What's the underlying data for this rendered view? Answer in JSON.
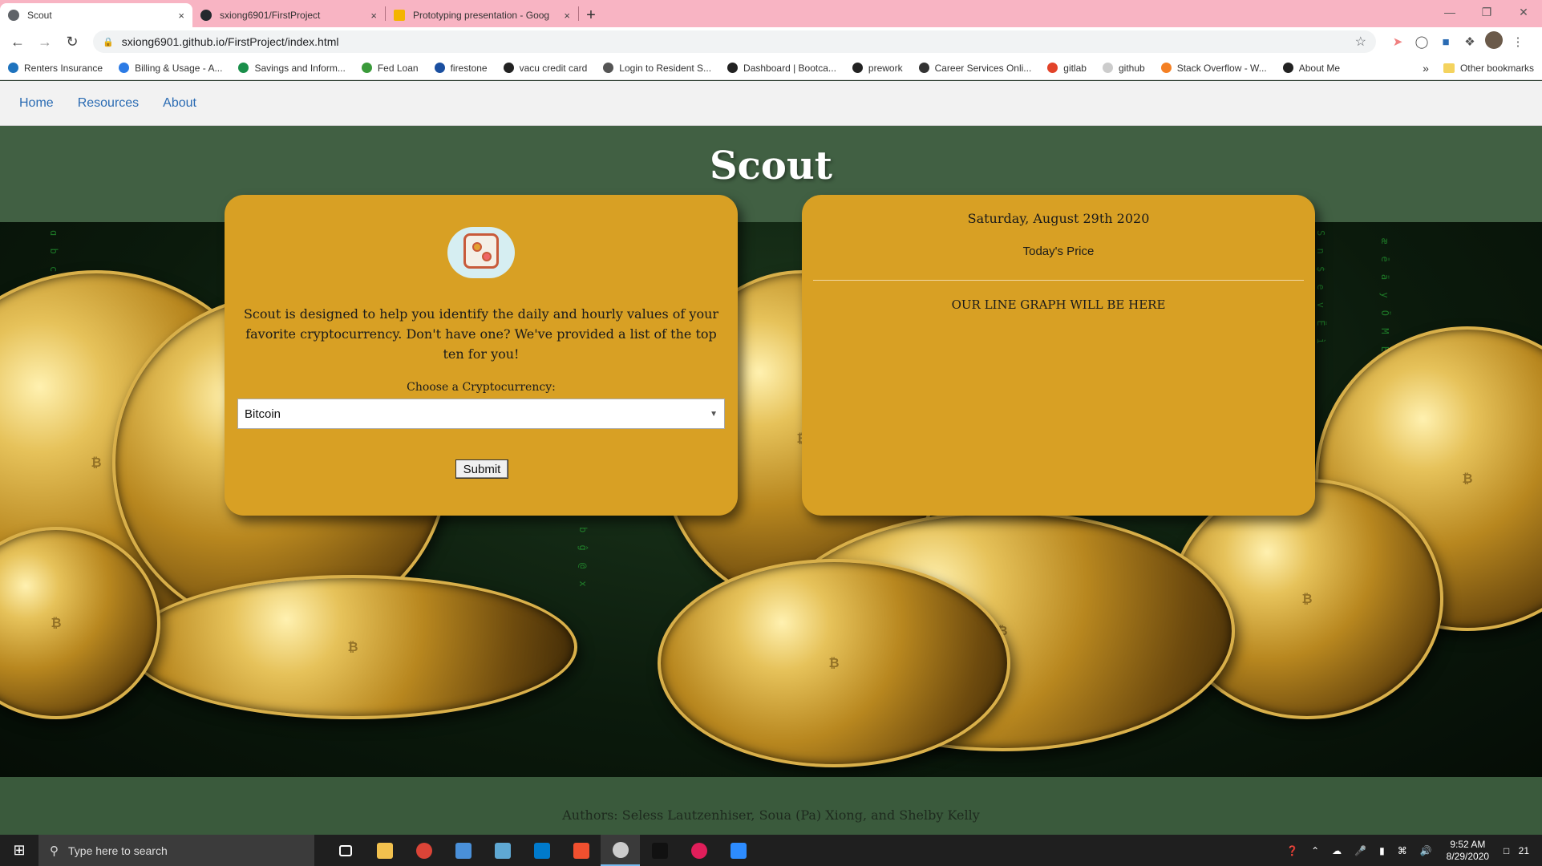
{
  "browser": {
    "tabs": [
      {
        "title": "Scout",
        "favicon_color": "#5f6368",
        "active": true
      },
      {
        "title": "sxiong6901/FirstProject",
        "favicon_color": "#24292e",
        "active": false
      },
      {
        "title": "Prototyping presentation - Goog",
        "favicon_color": "#f4b400",
        "active": false
      }
    ],
    "close_glyph": "×",
    "new_tab_glyph": "+",
    "url": "sxiong6901.github.io/FirstProject/index.html",
    "bookmarks": [
      {
        "label": "Renters Insurance",
        "color": "#1e73be"
      },
      {
        "label": "Billing & Usage - A...",
        "color": "#2c7be5"
      },
      {
        "label": "Savings and Inform...",
        "color": "#1a8f4a"
      },
      {
        "label": "Fed Loan",
        "color": "#3a9a3a"
      },
      {
        "label": "firestone",
        "color": "#1a4fa0"
      },
      {
        "label": "vacu credit card",
        "color": "#222222"
      },
      {
        "label": "Login to Resident S...",
        "color": "#555555"
      },
      {
        "label": "Dashboard | Bootca...",
        "color": "#222222"
      },
      {
        "label": "prework",
        "color": "#222222"
      },
      {
        "label": "Career Services Onli...",
        "color": "#333333"
      },
      {
        "label": "gitlab",
        "color": "#e24329"
      },
      {
        "label": "github",
        "color": "#cccccc"
      },
      {
        "label": "Stack Overflow - W...",
        "color": "#f48024"
      },
      {
        "label": "About Me",
        "color": "#222222"
      }
    ],
    "other_bookmarks": "Other bookmarks",
    "chevron": "»"
  },
  "site": {
    "nav": [
      "Home",
      "Resources",
      "About"
    ],
    "title": "Scout",
    "description": "Scout is designed to help you identify the daily and hourly values of your favorite cryptocurrency. Don't have one? We've provided a list of the top ten for you!",
    "choose_label": "Choose a Cryptocurrency:",
    "selected_crypto": "Bitcoin",
    "submit_label": "Submit",
    "date": "Saturday, August 29th 2020",
    "price_label": "Today's Price",
    "graph_placeholder": "OUR LINE GRAPH WILL BE HERE",
    "footer": "Authors: Seless Lautzenhiser, Soua (Pa) Xiong, and Shelby Kelly"
  },
  "taskbar": {
    "search_placeholder": "Type here to search",
    "apps": [
      {
        "name": "task-view",
        "color": "#ffffff"
      },
      {
        "name": "file-explorer",
        "color": "#f2c14e"
      },
      {
        "name": "chrome",
        "color": "#db4437"
      },
      {
        "name": "calculator",
        "color": "#4a90d9"
      },
      {
        "name": "notepad",
        "color": "#5fa8d3"
      },
      {
        "name": "vscode",
        "color": "#007acc"
      },
      {
        "name": "git",
        "color": "#f1502f"
      },
      {
        "name": "photos",
        "color": "#cccccc"
      },
      {
        "name": "terminal",
        "color": "#111111"
      },
      {
        "name": "slack",
        "color": "#e01e5a"
      },
      {
        "name": "zoom",
        "color": "#2d8cff"
      }
    ],
    "time": "9:52 AM",
    "date": "8/29/2020",
    "notifications": "21"
  }
}
